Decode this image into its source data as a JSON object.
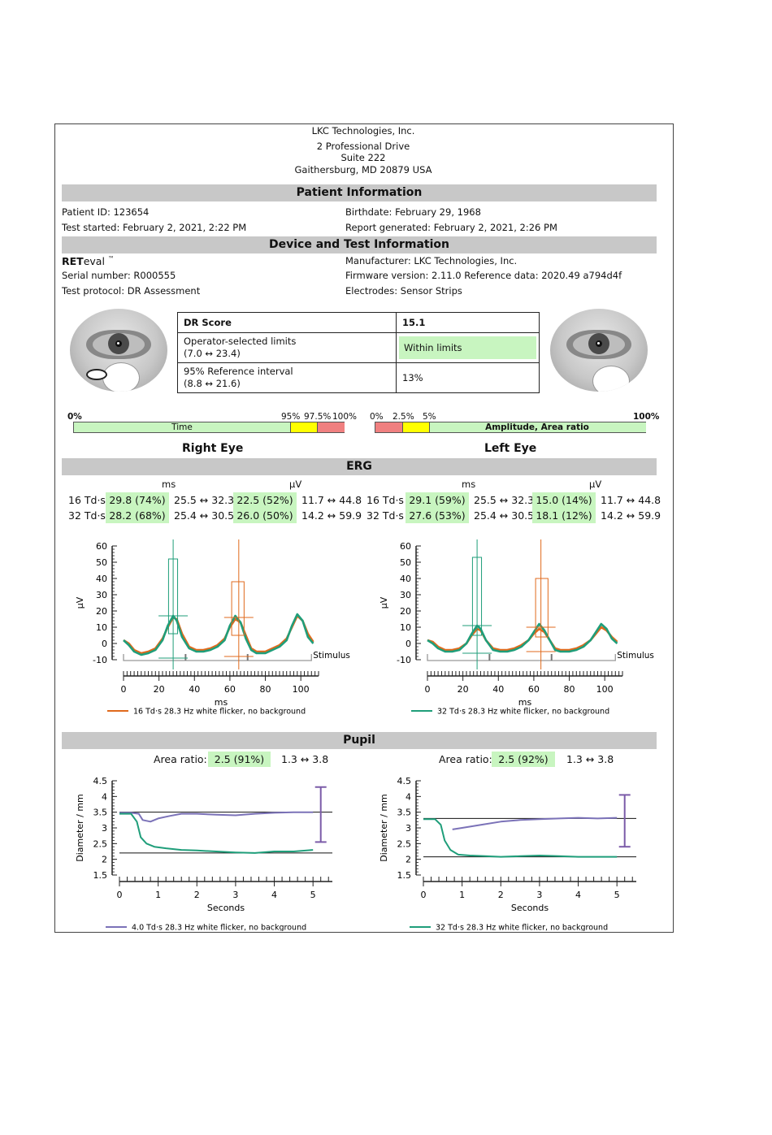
{
  "header": {
    "company": "LKC Technologies, Inc.",
    "address1": "2 Professional Drive",
    "address2": "Suite 222",
    "address3": "Gaithersburg, MD 20879 USA"
  },
  "patient": {
    "section_title": "Patient Information",
    "patient_id": "Patient ID: 123654",
    "birthdate": "Birthdate: February 29, 1968",
    "test_started": "Test started: February 2, 2021, 2:22 PM",
    "report_generated": "Report generated: February 2, 2021, 2:26 PM"
  },
  "device": {
    "section_title": "Device and Test Information",
    "name_bold": "RET",
    "name_rest": "eval",
    "tm": "™",
    "manufacturer": "Manufacturer: LKC Technologies, Inc.",
    "serial": "Serial number: R000555",
    "firmware": "Firmware version: 2.11.0 Reference data: 2020.49 a794d4f",
    "protocol": "Test protocol: DR Assessment",
    "electrodes": "Electrodes: Sensor Strips"
  },
  "dr_table": {
    "score_label": "DR Score",
    "score_value": "15.1",
    "limits_label": "Operator-selected limits",
    "limits_range": "(7.0 ↔ 23.4)",
    "limits_value": "Within limits",
    "ref_label": "95% Reference interval",
    "ref_range": "(8.8 ↔ 21.6)",
    "ref_value": "13%"
  },
  "scales": {
    "time": {
      "label": "Time",
      "l0": "0%",
      "l95": "95%",
      "l975": "97.5%",
      "l100": "100%"
    },
    "amp": {
      "label": "Amplitude, Area ratio",
      "l0": "0%",
      "l25": "2.5%",
      "l5": "5%",
      "l100": "100%"
    },
    "colors": {
      "green": "#c8f5c0",
      "yellow": "#ffff00",
      "red": "#f08080"
    }
  },
  "eyes": {
    "right": "Right Eye",
    "left": "Left Eye"
  },
  "erg": {
    "section_title": "ERG",
    "unit_ms": "ms",
    "unit_uv": "µV",
    "right": [
      {
        "label": "16 Td·s",
        "ms": "29.8 (74%)",
        "ms_range": "25.5 ↔ 32.3",
        "uv": "22.5 (52%)",
        "uv_range": "11.7 ↔ 44.8"
      },
      {
        "label": "32 Td·s",
        "ms": "28.2 (68%)",
        "ms_range": "25.4 ↔ 30.5",
        "uv": "26.0 (50%)",
        "uv_range": "14.2 ↔ 59.9"
      }
    ],
    "left": [
      {
        "label": "16 Td·s",
        "ms": "29.1 (59%)",
        "ms_range": "25.5 ↔ 32.3",
        "uv": "15.0 (14%)",
        "uv_range": "11.7 ↔ 44.8"
      },
      {
        "label": "32 Td·s",
        "ms": "27.6 (53%)",
        "ms_range": "25.4 ↔ 30.5",
        "uv": "18.1 (12%)",
        "uv_range": "14.2 ↔ 59.9"
      }
    ]
  },
  "pupil": {
    "section_title": "Pupil",
    "area_label": "Area ratio:",
    "right": {
      "value": "2.5 (91%)",
      "range": "1.3 ↔ 3.8"
    },
    "left": {
      "value": "2.5 (92%)",
      "range": "1.3 ↔ 3.8"
    }
  },
  "chart_data": [
    {
      "type": "line",
      "id": "erg-right",
      "xlabel": "ms",
      "ylabel": "µV",
      "xlim": [
        0,
        110
      ],
      "ylim": [
        -10,
        60
      ],
      "xticks": [
        0,
        20,
        40,
        60,
        80,
        100
      ],
      "yticks": [
        -10,
        0,
        10,
        20,
        30,
        40,
        50,
        60
      ],
      "annotation": "Stimulus",
      "legend": "16 Td·s 28.3 Hz white flicker, no background",
      "colors": [
        "#e06a1c",
        "#1f9e7a"
      ],
      "series": [
        {
          "name": "16 Td·s 28.3 Hz white flicker, no background",
          "x": [
            0,
            3,
            6,
            10,
            14,
            18,
            22,
            25,
            28,
            30,
            33,
            37,
            41,
            45,
            49,
            53,
            57,
            60,
            63,
            66,
            69,
            72,
            75,
            80,
            84,
            88,
            92,
            95,
            98,
            101,
            104,
            107
          ],
          "y": [
            2,
            0,
            -4,
            -6,
            -5,
            -3,
            3,
            10,
            16,
            15,
            6,
            -2,
            -4,
            -4,
            -3,
            -1,
            3,
            10,
            15,
            13,
            5,
            -3,
            -5,
            -5,
            -3,
            -1,
            3,
            10,
            17,
            14,
            6,
            1
          ]
        },
        {
          "x": [
            0,
            3,
            6,
            10,
            14,
            18,
            22,
            25,
            28,
            30,
            33,
            37,
            41,
            45,
            49,
            53,
            57,
            60,
            63,
            66,
            69,
            72,
            75,
            80,
            84,
            88,
            92,
            95,
            98,
            101,
            104,
            107
          ],
          "y": [
            2,
            -1,
            -5,
            -7,
            -6,
            -4,
            2,
            11,
            17,
            14,
            4,
            -3,
            -5,
            -5,
            -4,
            -2,
            2,
            11,
            17,
            13,
            3,
            -4,
            -6,
            -6,
            -4,
            -2,
            2,
            11,
            18,
            14,
            4,
            0
          ]
        }
      ],
      "markers": [
        {
          "color": "#1f9e7a",
          "x": 28,
          "x_lo": 25.4,
          "x_hi": 30.5,
          "y": 17,
          "y_lo": 6,
          "y_hi": 52,
          "peak_lo": -9
        },
        {
          "color": "#e06a1c",
          "x": 65,
          "x_lo": 61,
          "x_hi": 68,
          "y": 16,
          "y_lo": 5,
          "y_hi": 38,
          "peak_lo": -8
        }
      ]
    },
    {
      "type": "line",
      "id": "erg-left",
      "xlabel": "ms",
      "ylabel": "µV",
      "xlim": [
        0,
        110
      ],
      "ylim": [
        -10,
        60
      ],
      "xticks": [
        0,
        20,
        40,
        60,
        80,
        100
      ],
      "yticks": [
        -10,
        0,
        10,
        20,
        30,
        40,
        50,
        60
      ],
      "annotation": "Stimulus",
      "legend": "32 Td·s 28.3 Hz white flicker, no background",
      "colors": [
        "#e06a1c",
        "#1f9e7a"
      ],
      "series": [
        {
          "x": [
            0,
            3,
            6,
            10,
            14,
            18,
            22,
            25,
            28,
            30,
            33,
            37,
            41,
            45,
            49,
            53,
            57,
            60,
            63,
            66,
            69,
            72,
            75,
            80,
            84,
            88,
            92,
            95,
            98,
            101,
            104,
            107
          ],
          "y": [
            2,
            1,
            -2,
            -4,
            -4,
            -3,
            0,
            5,
            9,
            8,
            2,
            -3,
            -4,
            -4,
            -3,
            -1,
            2,
            6,
            9,
            7,
            2,
            -3,
            -4,
            -4,
            -3,
            -1,
            2,
            6,
            10,
            8,
            4,
            1
          ]
        },
        {
          "name": "32 Td·s 28.3 Hz white flicker, no background",
          "x": [
            0,
            3,
            6,
            10,
            14,
            18,
            22,
            25,
            28,
            30,
            33,
            37,
            41,
            45,
            49,
            53,
            57,
            60,
            63,
            66,
            69,
            72,
            75,
            80,
            84,
            88,
            92,
            95,
            98,
            101,
            104,
            107
          ],
          "y": [
            2,
            0,
            -3,
            -5,
            -5,
            -4,
            0,
            6,
            11,
            9,
            2,
            -4,
            -5,
            -5,
            -4,
            -2,
            2,
            7,
            12,
            8,
            2,
            -4,
            -5,
            -5,
            -4,
            -2,
            2,
            7,
            12,
            9,
            3,
            0
          ]
        }
      ],
      "markers": [
        {
          "color": "#1f9e7a",
          "x": 28,
          "x_lo": 25.4,
          "x_hi": 30.5,
          "y": 11,
          "y_lo": 5,
          "y_hi": 53,
          "peak_lo": -6
        },
        {
          "color": "#e06a1c",
          "x": 64,
          "x_lo": 61,
          "x_hi": 68,
          "y": 10,
          "y_lo": 4,
          "y_hi": 40,
          "peak_lo": -5
        }
      ]
    },
    {
      "type": "line",
      "id": "pupil-right",
      "xlabel": "Seconds",
      "ylabel": "Diameter / mm",
      "xlim": [
        0,
        5.5
      ],
      "ylim": [
        1.5,
        4.5
      ],
      "xticks": [
        0,
        1,
        2,
        3,
        4,
        5
      ],
      "yticks": [
        1.5,
        2,
        2.5,
        3,
        3.5,
        4,
        4.5
      ],
      "legend": "4.0 Td·s 28.3 Hz white flicker, no background",
      "colors": [
        "#7b72b8",
        "#1f9e7a"
      ],
      "series": [
        {
          "name": "4.0 Td·s 28.3 Hz white flicker, no background",
          "x": [
            0,
            0.3,
            0.5,
            0.6,
            0.8,
            1.0,
            1.3,
            1.6,
            2.0,
            2.5,
            3.0,
            3.5,
            4.0,
            4.5,
            5.0
          ],
          "y": [
            3.48,
            3.48,
            3.45,
            3.25,
            3.2,
            3.3,
            3.38,
            3.45,
            3.45,
            3.42,
            3.4,
            3.45,
            3.48,
            3.5,
            3.5
          ]
        },
        {
          "x": [
            0,
            0.3,
            0.45,
            0.55,
            0.7,
            0.9,
            1.2,
            1.6,
            2.0,
            2.5,
            3.0,
            3.5,
            4.0,
            4.5,
            5.0
          ],
          "y": [
            3.45,
            3.45,
            3.2,
            2.7,
            2.5,
            2.4,
            2.35,
            2.3,
            2.28,
            2.25,
            2.22,
            2.2,
            2.25,
            2.25,
            2.3
          ]
        }
      ],
      "ref_lines": [
        3.5,
        2.2
      ],
      "interval": {
        "x": 5.2,
        "lo": 2.55,
        "hi": 4.3,
        "color": "#7b5ba8"
      }
    },
    {
      "type": "line",
      "id": "pupil-left",
      "xlabel": "Seconds",
      "ylabel": "Diameter / mm",
      "xlim": [
        0,
        5.5
      ],
      "ylim": [
        1.5,
        4.5
      ],
      "xticks": [
        0,
        1,
        2,
        3,
        4,
        5
      ],
      "yticks": [
        1.5,
        2,
        2.5,
        3,
        3.5,
        4,
        4.5
      ],
      "legend": "32 Td·s 28.3 Hz white flicker, no background",
      "colors": [
        "#7b72b8",
        "#1f9e7a"
      ],
      "series": [
        {
          "x": [
            0.75,
            1.0,
            1.5,
            2.0,
            2.5,
            3.0,
            3.5,
            4.0,
            4.5,
            5.0
          ],
          "y": [
            2.95,
            3.0,
            3.1,
            3.2,
            3.25,
            3.28,
            3.3,
            3.32,
            3.3,
            3.32
          ]
        },
        {
          "name": "32 Td·s 28.3 Hz white flicker, no background",
          "x": [
            0,
            0.3,
            0.45,
            0.55,
            0.7,
            0.9,
            1.2,
            1.6,
            2.0,
            2.5,
            3.0,
            3.5,
            4.0,
            4.5,
            5.0
          ],
          "y": [
            3.28,
            3.28,
            3.1,
            2.6,
            2.3,
            2.15,
            2.12,
            2.1,
            2.08,
            2.1,
            2.12,
            2.1,
            2.08,
            2.08,
            2.08
          ]
        }
      ],
      "ref_lines": [
        3.3,
        2.08
      ],
      "interval": {
        "x": 5.2,
        "lo": 2.4,
        "hi": 4.05,
        "color": "#7b5ba8"
      }
    }
  ]
}
